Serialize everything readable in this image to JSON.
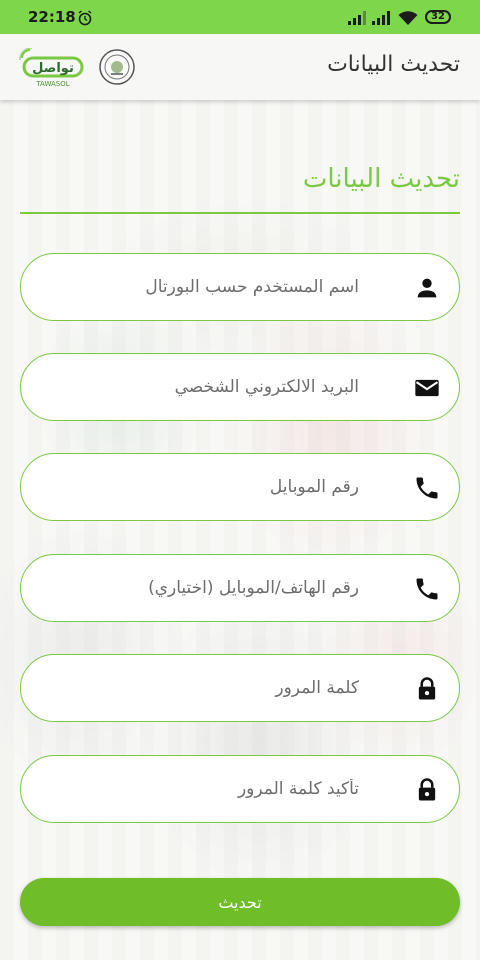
{
  "status_bar": {
    "time": "22:18",
    "battery": "32",
    "icons": [
      "alarm-icon",
      "signal-icon",
      "signal-icon",
      "wifi-icon",
      "battery-icon"
    ]
  },
  "app_bar": {
    "title": "تحديث البيانات",
    "brand_logo": "تواصل",
    "brand_logo_sub": "TAWASOL"
  },
  "form": {
    "heading": "تحديث البيانات",
    "fields": [
      {
        "placeholder": "اسم المستخدم حسب البورتال",
        "icon": "person-icon"
      },
      {
        "placeholder": "البريد الالكتروني الشخصي",
        "icon": "mail-icon"
      },
      {
        "placeholder": "رقم الموبايل",
        "icon": "phone-icon"
      },
      {
        "placeholder": "رقم الهاتف/الموبايل (اختياري)",
        "icon": "phone-icon"
      },
      {
        "placeholder": "كلمة المرور",
        "icon": "lock-icon"
      },
      {
        "placeholder": "تأكيد كلمة المرور",
        "icon": "lock-icon"
      }
    ],
    "submit_label": "تحديث"
  },
  "colors": {
    "accent": "#7ac943",
    "status_bar": "#7ed64b",
    "button": "#6fbd28"
  }
}
